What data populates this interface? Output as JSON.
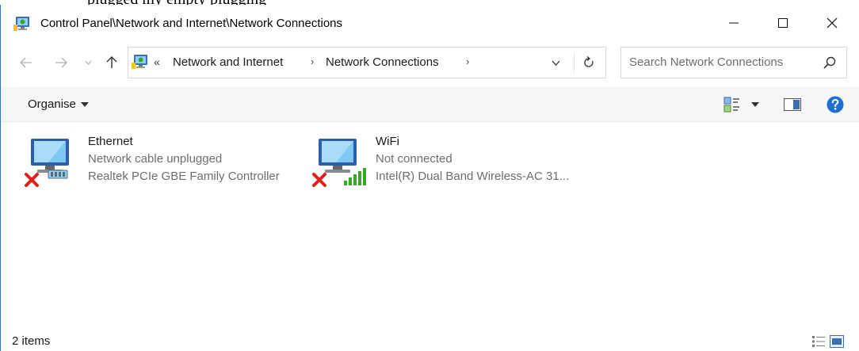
{
  "window": {
    "title": "Control Panel\\Network and Internet\\Network Connections"
  },
  "address": {
    "overflow": "«",
    "crumbs": [
      "Network and Internet",
      "Network Connections"
    ],
    "search_placeholder": "Search Network Connections"
  },
  "toolbar": {
    "organise_label": "Organise"
  },
  "connections": [
    {
      "name": "Ethernet",
      "status": "Network cable unplugged",
      "device": "Realtek PCIe GBE Family Controller",
      "icon": "ethernet-adapter-icon"
    },
    {
      "name": "WiFi",
      "status": "Not connected",
      "device": "Intel(R) Dual Band Wireless-AC 31...",
      "icon": "wifi-adapter-icon"
    }
  ],
  "statusbar": {
    "count": "2 items"
  },
  "colors": {
    "accent": "#2b79d7",
    "error_red": "#e0201c",
    "signal_green": "#3aa52a",
    "help_blue": "#1f6fd1"
  }
}
